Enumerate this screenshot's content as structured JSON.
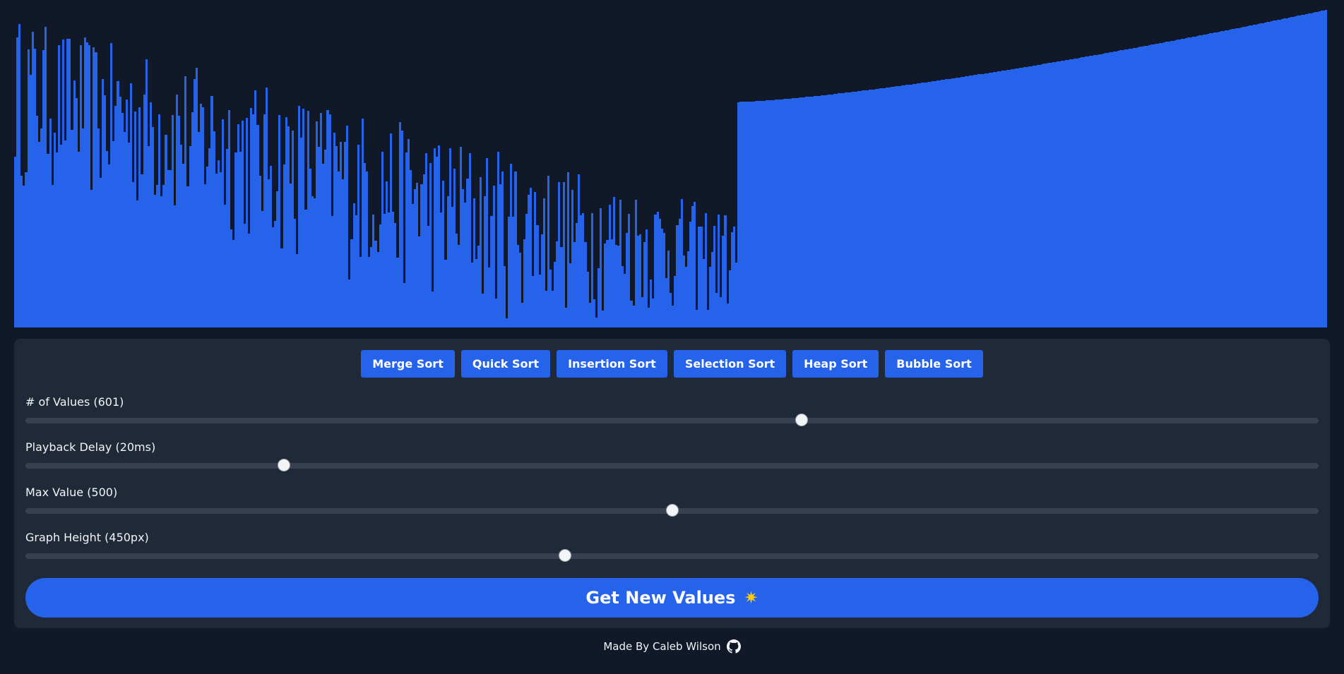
{
  "graph": {
    "bar_color": "#2563eb",
    "sorted_bar_count": 270
  },
  "sort_buttons": [
    "Merge Sort",
    "Quick Sort",
    "Insertion Sort",
    "Selection Sort",
    "Heap Sort",
    "Bubble Sort"
  ],
  "sliders": {
    "num_values": {
      "label": "# of Values (601)",
      "value": 0.6
    },
    "playback_delay": {
      "label": "Playback Delay (20ms)",
      "value": 0.2
    },
    "max_value": {
      "label": "Max Value (500)",
      "value": 0.5
    },
    "graph_height": {
      "label": "Graph Height (450px)",
      "value": 0.417
    }
  },
  "main_button": {
    "label": "Get New Values",
    "icon": "star-icon"
  },
  "footer": {
    "text": "Made By Caleb Wilson",
    "icon": "github-icon"
  },
  "colors": {
    "background": "#111827",
    "panel": "#1f2937",
    "accent": "#2563eb"
  }
}
